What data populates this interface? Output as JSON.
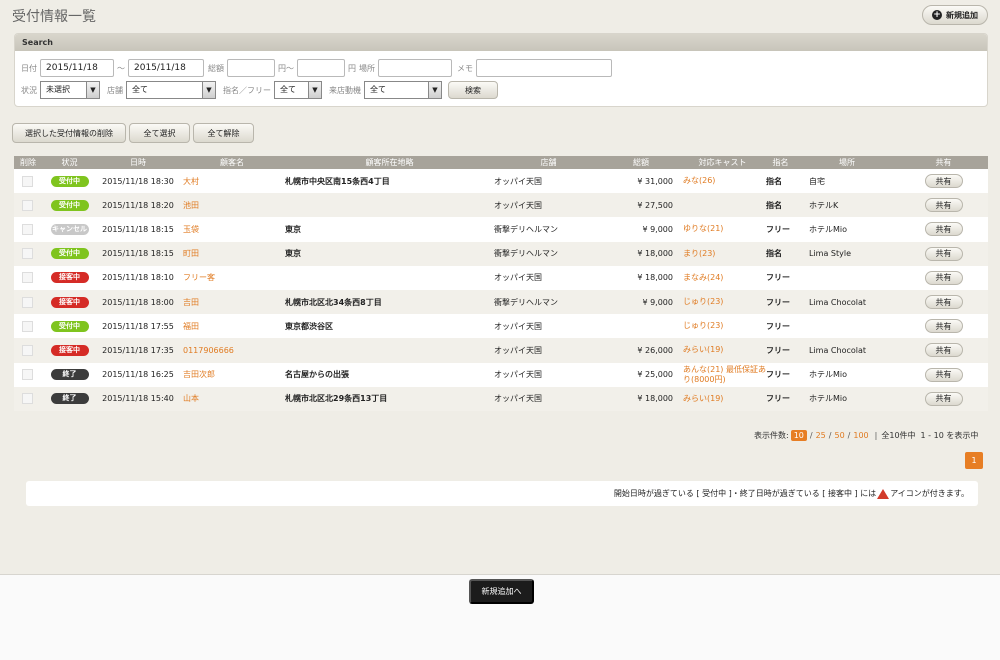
{
  "page": {
    "title": "受付情報一覧",
    "new_label": "新規追加"
  },
  "search": {
    "heading": "Search",
    "date_label": "日付",
    "date_from": "2015/11/18",
    "date_sep": "〜",
    "date_to": "2015/11/18",
    "total_label": "総額",
    "yen_from": "円〜",
    "yen_to": "円",
    "place_label": "場所",
    "memo_label": "メモ",
    "status_label": "状況",
    "status_value": "未選択",
    "store_label": "店舗",
    "store_value": "全て",
    "nomination_label": "指名／フリー",
    "nomination_value": "全て",
    "visit_label": "来店動機",
    "visit_value": "全て",
    "search_button": "検索"
  },
  "actions": {
    "delete_selected": "選択した受付情報の削除",
    "select_all": "全て選択",
    "deselect_all": "全て解除"
  },
  "table": {
    "headers": [
      "削除",
      "状況",
      "日時",
      "顧客名",
      "顧客所在地略",
      "店舗",
      "総額",
      "対応キャスト",
      "指名",
      "場所",
      "共有"
    ],
    "share_label": "共有",
    "rows": [
      {
        "status": "受付中",
        "status_color": "#7fc41e",
        "datetime": "2015/11/18 18:30",
        "customer": "大村",
        "address": "札幌市中央区南15条西4丁目",
        "store": "オッパイ天国",
        "total": "¥ 31,000",
        "cast": "みな(26)",
        "nomination": "指名",
        "place": "自宅"
      },
      {
        "status": "受付中",
        "status_color": "#7fc41e",
        "datetime": "2015/11/18 18:20",
        "customer": "池田",
        "address": "",
        "store": "オッパイ天国",
        "total": "¥ 27,500",
        "cast": "",
        "nomination": "指名",
        "place": "ホテルK"
      },
      {
        "status": "キャンセル",
        "status_color": "#c8c8c8",
        "datetime": "2015/11/18 18:15",
        "customer": "玉袋",
        "address": "東京",
        "store": "衝撃デリヘルマン",
        "total": "¥ 9,000",
        "cast": "ゆりな(21)",
        "nomination": "フリー",
        "place": "ホテルMio"
      },
      {
        "status": "受付中",
        "status_color": "#7fc41e",
        "datetime": "2015/11/18 18:15",
        "customer": "町田",
        "address": "東京",
        "store": "衝撃デリヘルマン",
        "total": "¥ 18,000",
        "cast": "まり(23)",
        "nomination": "指名",
        "place": "Lima Style"
      },
      {
        "status": "接客中",
        "status_color": "#d52b26",
        "datetime": "2015/11/18 18:10",
        "customer": "フリー客",
        "address": "",
        "store": "オッパイ天国",
        "total": "¥ 18,000",
        "cast": "まなみ(24)",
        "nomination": "フリー",
        "place": ""
      },
      {
        "status": "接客中",
        "status_color": "#d52b26",
        "datetime": "2015/11/18 18:00",
        "customer": "吉田",
        "address": "札幌市北区北34条西8丁目",
        "store": "衝撃デリヘルマン",
        "total": "¥ 9,000",
        "cast": "じゅり(23)",
        "nomination": "フリー",
        "place": "Lima Chocolat"
      },
      {
        "status": "受付中",
        "status_color": "#7fc41e",
        "datetime": "2015/11/18 17:55",
        "customer": "福田",
        "address": "東京都渋谷区",
        "store": "オッパイ天国",
        "total": "",
        "cast": "じゅり(23)",
        "nomination": "フリー",
        "place": ""
      },
      {
        "status": "接客中",
        "status_color": "#d52b26",
        "datetime": "2015/11/18 17:35",
        "customer": "0117906666",
        "address": "",
        "store": "オッパイ天国",
        "total": "¥ 26,000",
        "cast": "みらい(19)",
        "nomination": "フリー",
        "place": "Lima Chocolat"
      },
      {
        "status": "終了",
        "status_color": "#3c3c3c",
        "datetime": "2015/11/18 16:25",
        "customer": "吉田次郎",
        "address": "名古屋からの出張",
        "store": "オッパイ天国",
        "total": "¥ 25,000",
        "cast": "あんな(21)  最低保証あり(8000円)",
        "nomination": "フリー",
        "place": "ホテルMio"
      },
      {
        "status": "終了",
        "status_color": "#3c3c3c",
        "datetime": "2015/11/18 15:40",
        "customer": "山本",
        "address": "札幌市北区北29条西13丁目",
        "store": "オッパイ天国",
        "total": "¥ 18,000",
        "cast": "みらい(19)",
        "nomination": "フリー",
        "place": "ホテルMio"
      }
    ]
  },
  "pagination": {
    "per_page_label": "表示件数:",
    "options": [
      "10",
      "25",
      "50",
      "100"
    ],
    "active": "10",
    "total_text": "全10件中",
    "range_text": "1 - 10 を表示中",
    "current_page": "1"
  },
  "notice": {
    "text_before": "開始日時が過ぎている [ 受付中 ]・終了日時が過ぎている [ 接客中 ] には",
    "text_after": "アイコンが付きます。"
  },
  "footer": {
    "new_button": "新規追加へ"
  },
  "colors": {
    "accent": "#e77e24",
    "header_bg": "#a7a39a"
  }
}
